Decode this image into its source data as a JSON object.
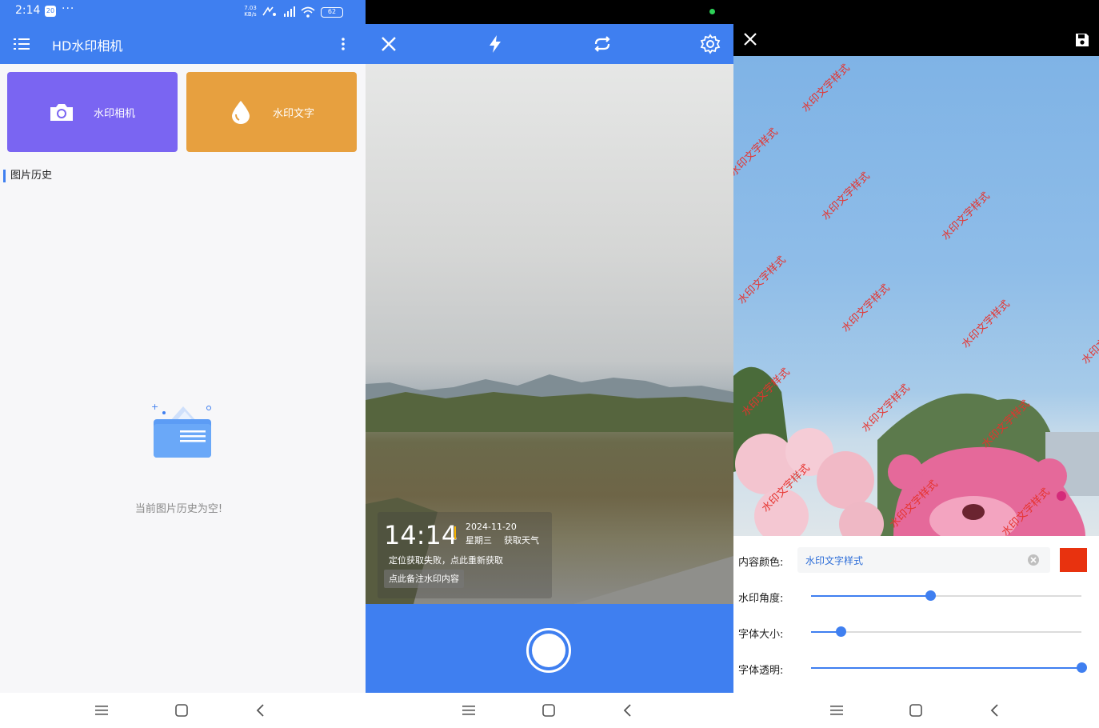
{
  "screen_home": {
    "status": {
      "time": "2:14",
      "badge": "20",
      "dots": "···",
      "net_speed": "7.03\nKB/s",
      "battery": "62"
    },
    "appbar": {
      "title": "HD水印相机"
    },
    "cards": [
      {
        "label": "水印相机",
        "icon": "camera-icon",
        "color": "#7a65f2"
      },
      {
        "label": "水印文字",
        "icon": "droplet-icon",
        "color": "#e7a03f"
      }
    ],
    "history_header": "图片历史",
    "empty_text": "当前图片历史为空!"
  },
  "screen_camera": {
    "toolbar_icons": [
      "close-icon",
      "flash-icon",
      "switch-camera-icon",
      "settings-icon"
    ],
    "watermark": {
      "time": "14:14",
      "date": "2024-11-20",
      "weekday": "星期三",
      "weather": "获取天气",
      "location": "定位获取失败，点此重新获取",
      "note": "点此备注水印内容"
    }
  },
  "screen_editor": {
    "stamp_text": "水印文字样式",
    "controls": {
      "content_color_label": "内容颜色:",
      "content_value": "水印文字样式",
      "swatch_color": "#e8320f",
      "angle_label": "水印角度:",
      "angle_value": 0.44,
      "size_label": "字体大小:",
      "size_value": 0.11,
      "opacity_label": "字体透明:",
      "opacity_value": 1.0
    }
  },
  "colors": {
    "primary": "#3f7ff0",
    "watermark_red": "#e6322d"
  }
}
